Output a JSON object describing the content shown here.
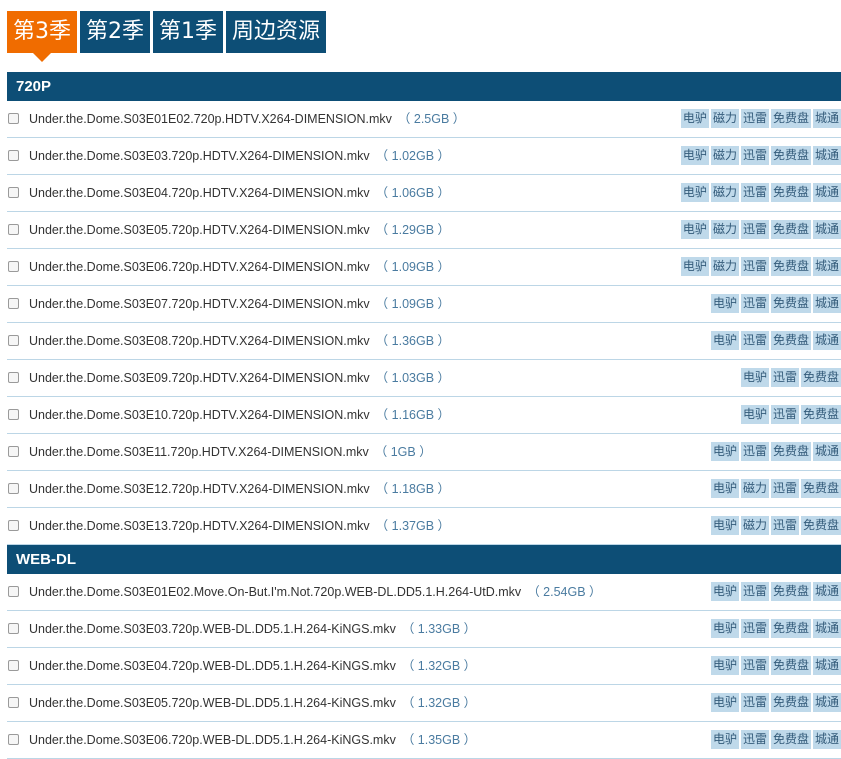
{
  "tabs": [
    {
      "label": "第3季",
      "active": true
    },
    {
      "label": "第2季",
      "active": false
    },
    {
      "label": "第1季",
      "active": false
    },
    {
      "label": "周边资源",
      "active": false
    }
  ],
  "colors": {
    "tab_active": "#f06c00",
    "tab": "#0d4e76",
    "header": "#0d4e76",
    "link_bg": "#bfd9ea"
  },
  "sections": [
    {
      "title": "720P",
      "rows": [
        {
          "name": "Under.the.Dome.S03E01E02.720p.HDTV.X264-DIMENSION.mkv",
          "size": "（ 2.5GB ）",
          "links": [
            "电驴",
            "磁力",
            "迅雷",
            "免费盘",
            "城通"
          ]
        },
        {
          "name": "Under.the.Dome.S03E03.720p.HDTV.X264-DIMENSION.mkv",
          "size": "（ 1.02GB ）",
          "links": [
            "电驴",
            "磁力",
            "迅雷",
            "免费盘",
            "城通"
          ]
        },
        {
          "name": "Under.the.Dome.S03E04.720p.HDTV.X264-DIMENSION.mkv",
          "size": "（ 1.06GB ）",
          "links": [
            "电驴",
            "磁力",
            "迅雷",
            "免费盘",
            "城通"
          ]
        },
        {
          "name": "Under.the.Dome.S03E05.720p.HDTV.X264-DIMENSION.mkv",
          "size": "（ 1.29GB ）",
          "links": [
            "电驴",
            "磁力",
            "迅雷",
            "免费盘",
            "城通"
          ]
        },
        {
          "name": "Under.the.Dome.S03E06.720p.HDTV.X264-DIMENSION.mkv",
          "size": "（ 1.09GB ）",
          "links": [
            "电驴",
            "磁力",
            "迅雷",
            "免费盘",
            "城通"
          ]
        },
        {
          "name": "Under.the.Dome.S03E07.720p.HDTV.X264-DIMENSION.mkv",
          "size": "（ 1.09GB ）",
          "links": [
            "电驴",
            "迅雷",
            "免费盘",
            "城通"
          ]
        },
        {
          "name": "Under.the.Dome.S03E08.720p.HDTV.X264-DIMENSION.mkv",
          "size": "（ 1.36GB ）",
          "links": [
            "电驴",
            "迅雷",
            "免费盘",
            "城通"
          ]
        },
        {
          "name": "Under.the.Dome.S03E09.720p.HDTV.X264-DIMENSION.mkv",
          "size": "（ 1.03GB ）",
          "links": [
            "电驴",
            "迅雷",
            "免费盘"
          ]
        },
        {
          "name": "Under.the.Dome.S03E10.720p.HDTV.X264-DIMENSION.mkv",
          "size": "（ 1.16GB ）",
          "links": [
            "电驴",
            "迅雷",
            "免费盘"
          ]
        },
        {
          "name": "Under.the.Dome.S03E11.720p.HDTV.X264-DIMENSION.mkv",
          "size": "（ 1GB ）",
          "links": [
            "电驴",
            "迅雷",
            "免费盘",
            "城通"
          ]
        },
        {
          "name": "Under.the.Dome.S03E12.720p.HDTV.X264-DIMENSION.mkv",
          "size": "（ 1.18GB ）",
          "links": [
            "电驴",
            "磁力",
            "迅雷",
            "免费盘"
          ]
        },
        {
          "name": "Under.the.Dome.S03E13.720p.HDTV.X264-DIMENSION.mkv",
          "size": "（ 1.37GB ）",
          "links": [
            "电驴",
            "磁力",
            "迅雷",
            "免费盘"
          ]
        }
      ]
    },
    {
      "title": "WEB-DL",
      "rows": [
        {
          "name": "Under.the.Dome.S03E01E02.Move.On-But.I'm.Not.720p.WEB-DL.DD5.1.H.264-UtD.mkv",
          "size": "（ 2.54GB ）",
          "links": [
            "电驴",
            "迅雷",
            "免费盘",
            "城通"
          ]
        },
        {
          "name": "Under.the.Dome.S03E03.720p.WEB-DL.DD5.1.H.264-KiNGS.mkv",
          "size": "（ 1.33GB ）",
          "links": [
            "电驴",
            "迅雷",
            "免费盘",
            "城通"
          ]
        },
        {
          "name": "Under.the.Dome.S03E04.720p.WEB-DL.DD5.1.H.264-KiNGS.mkv",
          "size": "（ 1.32GB ）",
          "links": [
            "电驴",
            "迅雷",
            "免费盘",
            "城通"
          ]
        },
        {
          "name": "Under.the.Dome.S03E05.720p.WEB-DL.DD5.1.H.264-KiNGS.mkv",
          "size": "（ 1.32GB ）",
          "links": [
            "电驴",
            "迅雷",
            "免费盘",
            "城通"
          ]
        },
        {
          "name": "Under.the.Dome.S03E06.720p.WEB-DL.DD5.1.H.264-KiNGS.mkv",
          "size": "（ 1.35GB ）",
          "links": [
            "电驴",
            "迅雷",
            "免费盘",
            "城通"
          ]
        }
      ]
    }
  ]
}
